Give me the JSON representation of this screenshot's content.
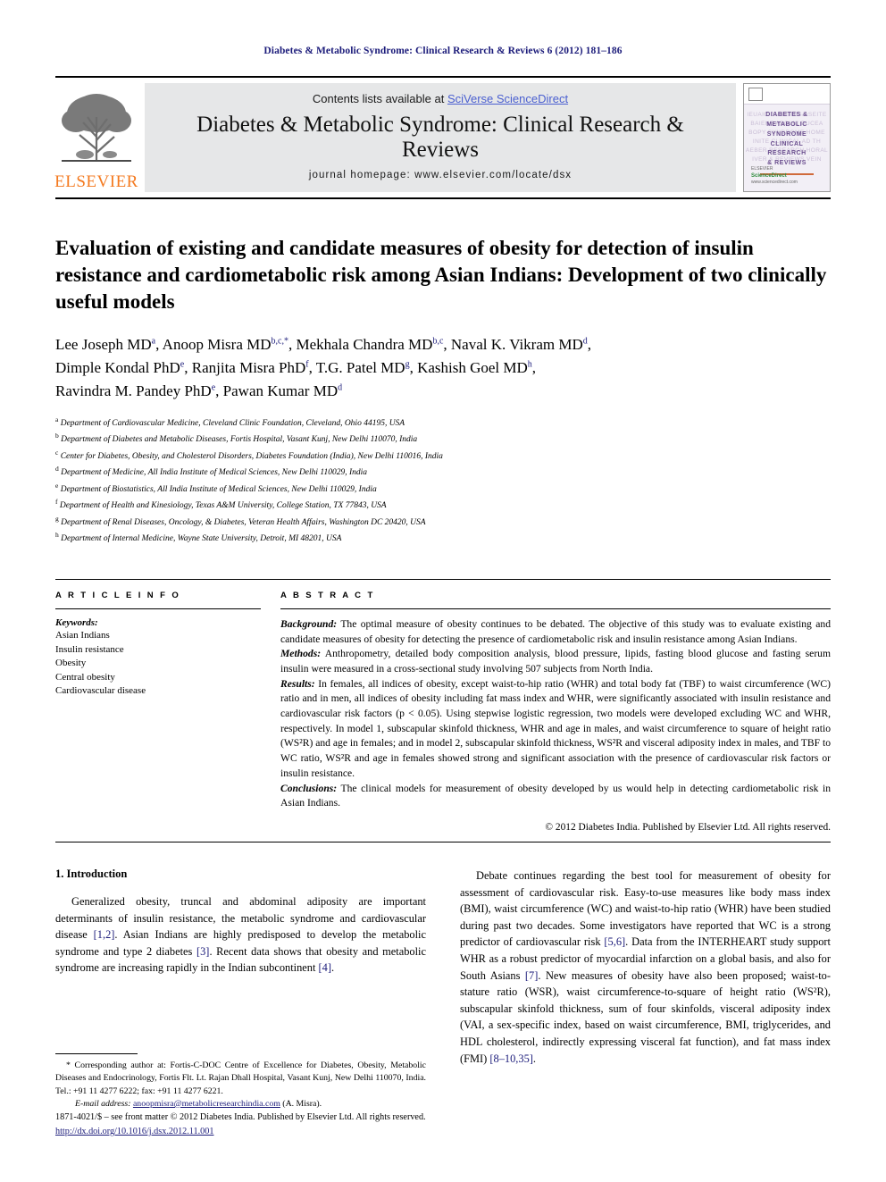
{
  "running_head": "Diabetes & Metabolic Syndrome: Clinical Research & Reviews 6 (2012) 181–186",
  "masthead": {
    "publisher_name": "ELSEVIER",
    "contents_prefix": "Contents lists available at ",
    "contents_link": "SciVerse ScienceDirect",
    "journal_title": "Diabetes & Metabolic Syndrome: Clinical Research & Reviews",
    "homepage_line": "journal homepage: www.elsevier.com/locate/dsx",
    "cover": {
      "ghost_lines": [
        "IEUAIC DIABETES& SEITE",
        "BAIENE ABOLIC DUCEA",
        "BOPY SYNDROME HOME",
        "INITE CLINICAL AD TH",
        "AEBER RESEARCH HORAL",
        "IVER & REVIEWS VEIN"
      ],
      "title_lines": [
        "DIABETES &",
        "METABOLIC",
        "SYNDROME",
        "CLINICAL",
        "RESEARCH",
        "& REVIEWS"
      ],
      "footer_top": "ELSEVIER",
      "footer_green": "ScienceDirect",
      "footer_bottom": "www.sciencedirect.com"
    }
  },
  "article": {
    "title": "Evaluation of existing and candidate measures of obesity for detection of insulin resistance and cardiometabolic risk among Asian Indians: Development of two clinically useful models",
    "authors_lines": [
      [
        {
          "name": "Lee Joseph MD",
          "sup": "a",
          "sep": ", "
        },
        {
          "name": "Anoop Misra MD",
          "sup": "b,c,*",
          "sep": ", "
        },
        {
          "name": "Mekhala Chandra MD",
          "sup": "b,c",
          "sep": ", "
        },
        {
          "name": "Naval K. Vikram MD",
          "sup": "d",
          "sep": ","
        }
      ],
      [
        {
          "name": "Dimple Kondal PhD",
          "sup": "e",
          "sep": ", "
        },
        {
          "name": "Ranjita Misra PhD",
          "sup": "f",
          "sep": ", "
        },
        {
          "name": "T.G. Patel MD",
          "sup": "g",
          "sep": ", "
        },
        {
          "name": "Kashish Goel MD",
          "sup": "h",
          "sep": ","
        }
      ],
      [
        {
          "name": "Ravindra M. Pandey PhD",
          "sup": "e",
          "sep": ", "
        },
        {
          "name": "Pawan Kumar MD",
          "sup": "d",
          "sep": ""
        }
      ]
    ],
    "affiliations": [
      {
        "mark": "a",
        "text": "Department of Cardiovascular Medicine, Cleveland Clinic Foundation, Cleveland, Ohio 44195, USA"
      },
      {
        "mark": "b",
        "text": "Department of Diabetes and Metabolic Diseases, Fortis Hospital, Vasant Kunj, New Delhi 110070, India"
      },
      {
        "mark": "c",
        "text": "Center for Diabetes, Obesity, and Cholesterol Disorders, Diabetes Foundation (India), New Delhi 110016, India"
      },
      {
        "mark": "d",
        "text": "Department of Medicine, All India Institute of Medical Sciences, New Delhi 110029, India"
      },
      {
        "mark": "e",
        "text": "Department of Biostatistics, All India Institute of Medical Sciences, New Delhi 110029, India"
      },
      {
        "mark": "f",
        "text": "Department of Health and Kinesiology, Texas A&M University, College Station, TX 77843, USA"
      },
      {
        "mark": "g",
        "text": "Department of Renal Diseases, Oncology, & Diabetes, Veteran Health Affairs, Washington DC 20420, USA"
      },
      {
        "mark": "h",
        "text": "Department of Internal Medicine, Wayne State University, Detroit, MI 48201, USA"
      }
    ]
  },
  "article_info": {
    "heading": "A R T I C L E    I N F O",
    "keywords_label": "Keywords:",
    "keywords": [
      "Asian Indians",
      "Insulin resistance",
      "Obesity",
      "Central obesity",
      "Cardiovascular disease"
    ]
  },
  "abstract": {
    "heading": "A B S T R A C T",
    "sections": [
      {
        "label": "Background:",
        "text": " The optimal measure of obesity continues to be debated. The objective of this study was to evaluate existing and candidate measures of obesity for detecting the presence of cardiometabolic risk and insulin resistance among Asian Indians."
      },
      {
        "label": "Methods:",
        "text": " Anthropometry, detailed body composition analysis, blood pressure, lipids, fasting blood glucose and fasting serum insulin were measured in a cross-sectional study involving 507 subjects from North India."
      },
      {
        "label": "Results:",
        "text": " In females, all indices of obesity, except waist-to-hip ratio (WHR) and total body fat (TBF) to waist circumference (WC) ratio and in men, all indices of obesity including fat mass index and WHR, were significantly associated with insulin resistance and cardiovascular risk factors (p < 0.05). Using stepwise logistic regression, two models were developed excluding WC and WHR, respectively. In model 1, subscapular skinfold thickness, WHR and age in males, and waist circumference to square of height ratio (WS²R) and age in females; and in model 2, subscapular skinfold thickness, WS²R and visceral adiposity index in males, and TBF to WC ratio, WS²R and age in females showed strong and significant association with the presence of cardiovascular risk factors or insulin resistance."
      },
      {
        "label": "Conclusions:",
        "text": " The clinical models for measurement of obesity developed by us would help in detecting cardiometabolic risk in Asian Indians."
      }
    ],
    "copyright": "© 2012 Diabetes India. Published by Elsevier Ltd. All rights reserved."
  },
  "introduction": {
    "heading": "1. Introduction",
    "left_paragraph": "Generalized obesity, truncal and abdominal adiposity are important determinants of insulin resistance, the metabolic syndrome and cardiovascular disease [1,2]. Asian Indians are highly predisposed to develop the metabolic syndrome and type 2 diabetes [3]. Recent data shows that obesity and metabolic syndrome are increasing rapidly in the Indian subcontinent [4].",
    "right_paragraph": "Debate continues regarding the best tool for measurement of obesity for assessment of cardiovascular risk. Easy-to-use measures like body mass index (BMI), waist circumference (WC) and waist-to-hip ratio (WHR) have been studied during past two decades. Some investigators have reported that WC is a strong predictor of cardiovascular risk [5,6]. Data from the INTERHEART study support WHR as a robust predictor of myocardial infarction on a global basis, and also for South Asians [7]. New measures of obesity have also been proposed; waist-to-stature ratio (WSR), waist circumference-to-square of height ratio (WS²R), subscapular skinfold thickness, sum of four skinfolds, visceral adiposity index (VAI, a sex-specific index, based on waist circumference, BMI, triglycerides, and HDL cholesterol, indirectly expressing visceral fat function), and fat mass index (FMI) [8–10,35]."
  },
  "footnote": {
    "corresponding": "* Corresponding author at: Fortis-C-DOC Centre of Excellence for Diabetes, Obesity, Metabolic Diseases and Endocrinology, Fortis Flt. Lt. Rajan Dhall Hospital, Vasant Kunj, New Delhi 110070, India. Tel.: +91 11 4277 6222; fax: +91 11 4277 6221.",
    "email_label": "E-mail address:",
    "email": "anoopmisra@metabolicresearchindia.com",
    "email_suffix": " (A. Misra)."
  },
  "page_footer": {
    "issn_line": "1871-4021/$ – see front matter © 2012 Diabetes India. Published by Elsevier Ltd. All rights reserved.",
    "doi": "http://dx.doi.org/10.1016/j.dsx.2012.11.001"
  },
  "colors": {
    "link_blue": "#1b1b7a",
    "sciencedirect_blue": "#4a5fd0",
    "elsevier_orange": "#F47A20",
    "masthead_gray": "#e6e7e8"
  }
}
